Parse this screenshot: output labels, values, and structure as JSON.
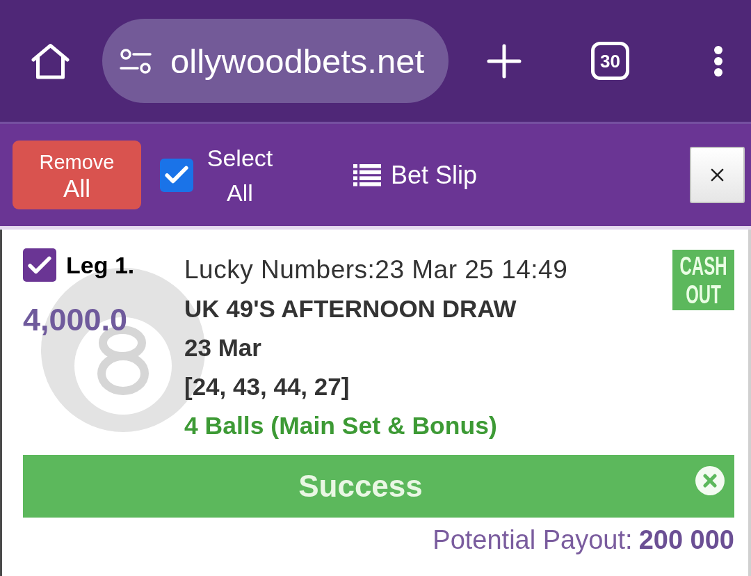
{
  "browser_bar": {
    "url": "ollywoodbets.net",
    "tab_count": "30"
  },
  "bet_slip_header": {
    "remove_all": {
      "label_lines": [
        "Remove",
        "All"
      ]
    },
    "select_all": {
      "label": "Select All",
      "checked": true
    },
    "title": "Bet Slip"
  },
  "legs": [
    {
      "checked": true,
      "label": "Leg 1.",
      "stake": "4,000.0",
      "cash_out": "CASH OUT",
      "details": [
        {
          "kind": "market",
          "text": "Lucky Numbers:23 Mar 25 14:49"
        },
        {
          "kind": "event",
          "text": "UK 49'S AFTERNOON DRAW"
        },
        {
          "kind": "date",
          "text": "23 Mar"
        },
        {
          "kind": "numbers",
          "text": "[24, 43, 44, 27]"
        },
        {
          "kind": "bet_type",
          "text": "4 Balls (Main Set & Bonus)"
        }
      ]
    }
  ],
  "status": {
    "kind": "success",
    "message": "Success"
  },
  "payout": {
    "label": "Potential Payout:",
    "value": "200 000"
  }
}
